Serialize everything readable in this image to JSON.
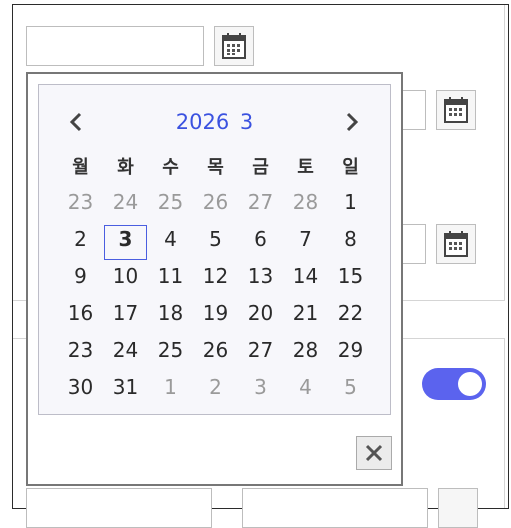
{
  "datepicker": {
    "year": "2026",
    "month": "3",
    "prev_icon": "chevron-left-icon",
    "next_icon": "chevron-right-icon",
    "close_icon": "close-icon",
    "weekdays": [
      "월",
      "화",
      "수",
      "목",
      "금",
      "토",
      "일"
    ],
    "weeks": [
      [
        {
          "d": "23",
          "o": true
        },
        {
          "d": "24",
          "o": true
        },
        {
          "d": "25",
          "o": true
        },
        {
          "d": "26",
          "o": true
        },
        {
          "d": "27",
          "o": true
        },
        {
          "d": "28",
          "o": true
        },
        {
          "d": "1",
          "o": false
        }
      ],
      [
        {
          "d": "2",
          "o": false
        },
        {
          "d": "3",
          "o": false,
          "t": true
        },
        {
          "d": "4",
          "o": false
        },
        {
          "d": "5",
          "o": false
        },
        {
          "d": "6",
          "o": false
        },
        {
          "d": "7",
          "o": false
        },
        {
          "d": "8",
          "o": false
        }
      ],
      [
        {
          "d": "9",
          "o": false
        },
        {
          "d": "10",
          "o": false
        },
        {
          "d": "11",
          "o": false
        },
        {
          "d": "12",
          "o": false
        },
        {
          "d": "13",
          "o": false
        },
        {
          "d": "14",
          "o": false
        },
        {
          "d": "15",
          "o": false
        }
      ],
      [
        {
          "d": "16",
          "o": false
        },
        {
          "d": "17",
          "o": false
        },
        {
          "d": "18",
          "o": false
        },
        {
          "d": "19",
          "o": false
        },
        {
          "d": "20",
          "o": false
        },
        {
          "d": "21",
          "o": false
        },
        {
          "d": "22",
          "o": false
        }
      ],
      [
        {
          "d": "23",
          "o": false
        },
        {
          "d": "24",
          "o": false
        },
        {
          "d": "25",
          "o": false
        },
        {
          "d": "26",
          "o": false
        },
        {
          "d": "27",
          "o": false
        },
        {
          "d": "28",
          "o": false
        },
        {
          "d": "29",
          "o": false
        }
      ],
      [
        {
          "d": "30",
          "o": false
        },
        {
          "d": "31",
          "o": false
        },
        {
          "d": "1",
          "o": true
        },
        {
          "d": "2",
          "o": true
        },
        {
          "d": "3",
          "o": true
        },
        {
          "d": "4",
          "o": true
        },
        {
          "d": "5",
          "o": true
        }
      ]
    ]
  },
  "background_form": {
    "calendar_icon": "calendar-icon",
    "toggle": {
      "on": true,
      "color": "#5b63ee"
    }
  },
  "colors": {
    "accent": "#3b52e0",
    "muted": "#9a9a9a"
  }
}
